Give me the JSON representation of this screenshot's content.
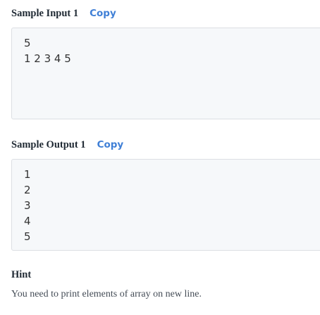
{
  "copy_label": "Copy",
  "sample_input": {
    "title": "Sample Input 1",
    "lines": [
      "5",
      "1 2 3 4 5"
    ]
  },
  "sample_output": {
    "title": "Sample Output 1",
    "lines": [
      "1",
      "2",
      "3",
      "4",
      "5"
    ]
  },
  "hint": {
    "title": "Hint",
    "text": "You need to print elements of array on new line."
  }
}
